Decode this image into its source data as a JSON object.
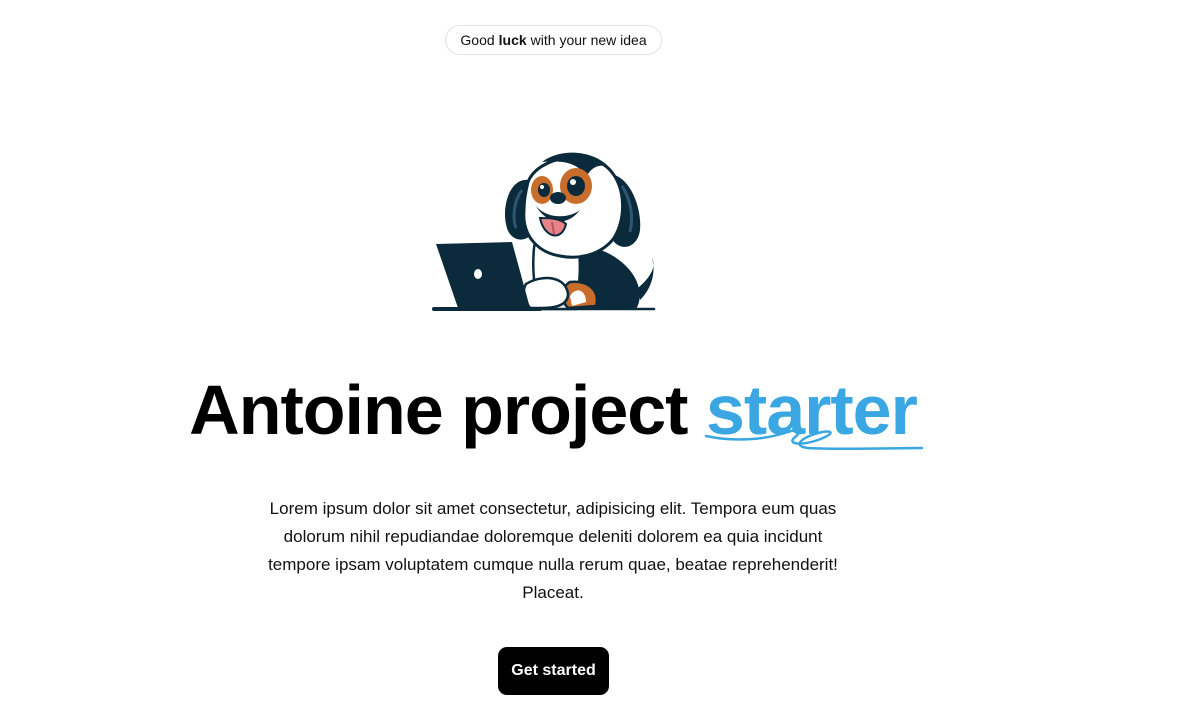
{
  "announcement": {
    "prefix": "Good",
    "emphasis": "luck",
    "suffix": "with your new idea"
  },
  "hero": {
    "mascot_icon": "dog-with-laptop-illustration",
    "title_main": "Antoine project",
    "title_accent": "starter",
    "description": "Lorem ipsum dolor sit amet consectetur, adipisicing elit. Tempora eum quas dolorum nihil repudiandae doloremque deleniti dolorem ea quia incidunt tempore ipsam voluptatem cumque nulla rerum quae, beatae reprehenderit! Placeat.",
    "cta_label": "Get started"
  },
  "colors": {
    "accent": "#3aa7e2",
    "button_bg": "#000000",
    "button_text": "#ffffff"
  }
}
